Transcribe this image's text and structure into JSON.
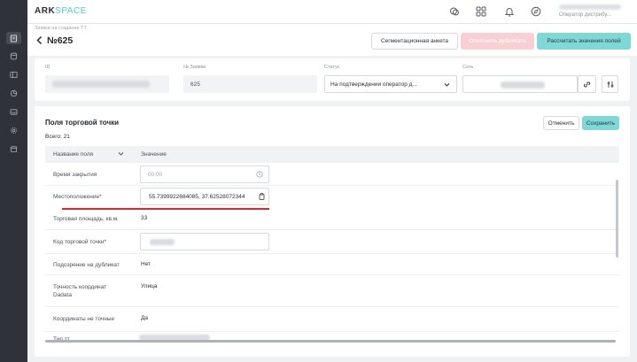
{
  "brand": {
    "part1": "ARK",
    "part2": "SPACE"
  },
  "header": {
    "user_role": "Оператор дистрибу..."
  },
  "titlebar": {
    "breadcrumb": "Заявки на создание ТТ",
    "title": "№625",
    "btn_segment": "Сегментационная анкета",
    "btn_dup": "Отклонить дубликать",
    "btn_calc": "Рассчитать значения полей"
  },
  "info": {
    "id_label": "ID",
    "req_label": "№ Заявки",
    "req_value": "625",
    "status_label": "Статус",
    "status_value": "На подтверждении оператор д...",
    "net_label": "Сеть"
  },
  "fields": {
    "title": "Поля торговой точки",
    "total": "Всего: 21",
    "btn_cancel": "Отменить",
    "btn_save": "Сохранить",
    "col_name": "Название поля",
    "col_value": "Значение",
    "rows": [
      {
        "name": "Время закрытия",
        "value": "00:00"
      },
      {
        "name": "Местоположение*",
        "value": "55.7399922684085, 37.62528072344"
      },
      {
        "name": "Торговая площадь, кв.м.",
        "value": "33"
      },
      {
        "name": "Код торговой точки*",
        "value": ""
      },
      {
        "name": "Подозрение на дубликат",
        "value": "Нет"
      },
      {
        "name": "Точность координат Dadata",
        "value": "Улица"
      },
      {
        "name": "Координаты не точные",
        "value": "Да"
      },
      {
        "name": "Тип тт",
        "value": ""
      }
    ]
  },
  "colors": {
    "sidebar": "#2f3238",
    "accent": "#4fd1c5",
    "save_button": "#7fd8d6",
    "danger_underline": "#e5242b"
  }
}
